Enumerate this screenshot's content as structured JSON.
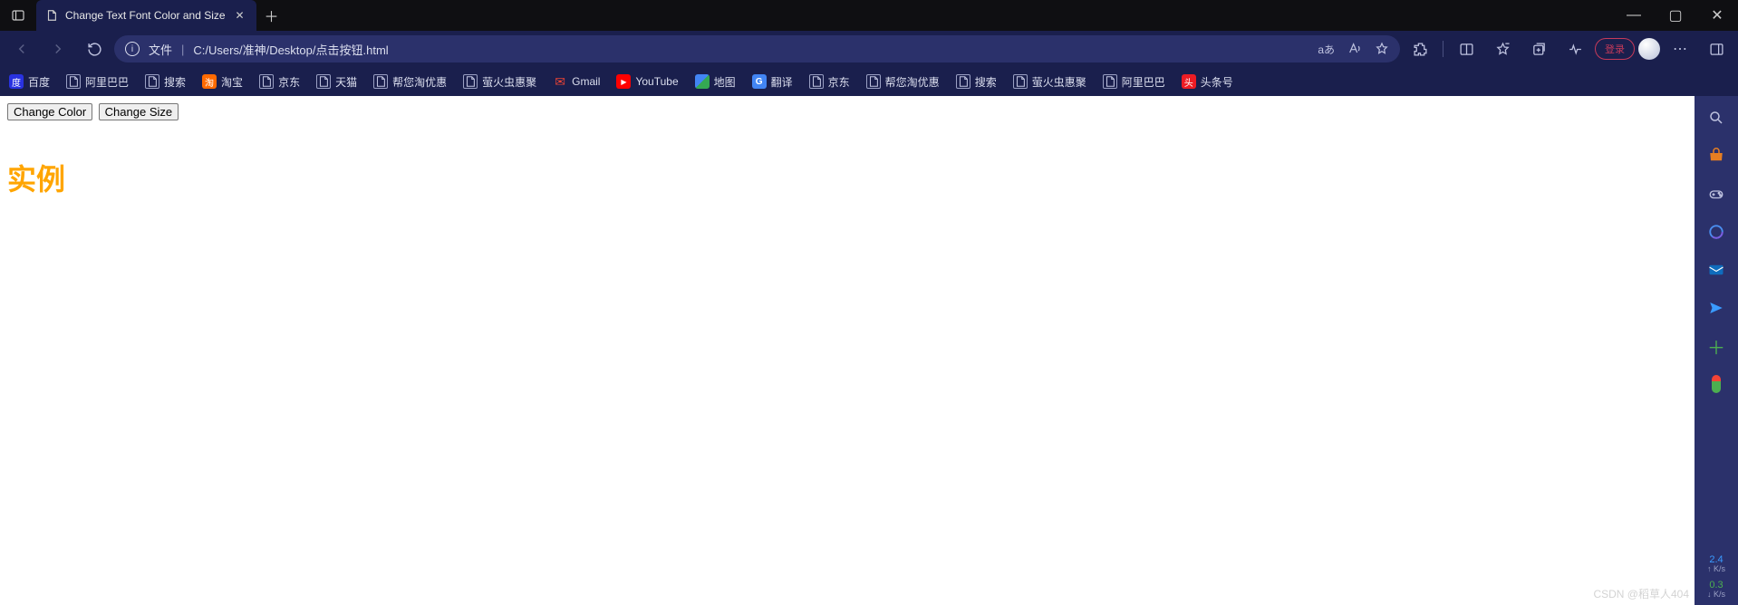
{
  "titlebar": {
    "tab_title": "Change Text Font Color and Size"
  },
  "window_controls": {
    "min": "—",
    "max": "▢",
    "close": "✕"
  },
  "toolbar": {
    "file_label": "文件",
    "url": "C:/Users/准神/Desktop/点击按钮.html",
    "reader_glyph": "aあ",
    "login_label": "登录"
  },
  "bookmarks": [
    {
      "label": "百度",
      "icon": "baidu"
    },
    {
      "label": "阿里巴巴",
      "icon": "doc"
    },
    {
      "label": "搜索",
      "icon": "doc"
    },
    {
      "label": "淘宝",
      "icon": "taobao"
    },
    {
      "label": "京东",
      "icon": "doc"
    },
    {
      "label": "天猫",
      "icon": "doc"
    },
    {
      "label": "帮您淘优惠",
      "icon": "doc"
    },
    {
      "label": "萤火虫惠聚",
      "icon": "doc"
    },
    {
      "label": "Gmail",
      "icon": "gmail"
    },
    {
      "label": "YouTube",
      "icon": "youtube"
    },
    {
      "label": "地图",
      "icon": "maps"
    },
    {
      "label": "翻译",
      "icon": "translate"
    },
    {
      "label": "京东",
      "icon": "doc"
    },
    {
      "label": "帮您淘优惠",
      "icon": "doc"
    },
    {
      "label": "搜索",
      "icon": "doc"
    },
    {
      "label": "萤火虫惠聚",
      "icon": "doc"
    },
    {
      "label": "阿里巴巴",
      "icon": "doc"
    },
    {
      "label": "头条号",
      "icon": "toutiao"
    }
  ],
  "page": {
    "btn_color": "Change Color",
    "btn_size": "Change Size",
    "heading": "实例"
  },
  "sidebar": {
    "stat1_num": "2.4",
    "stat1_unit": "↑ K/s",
    "stat2_num": "0.3",
    "stat2_unit": "↓ K/s"
  },
  "watermark": "CSDN @稻草人404"
}
